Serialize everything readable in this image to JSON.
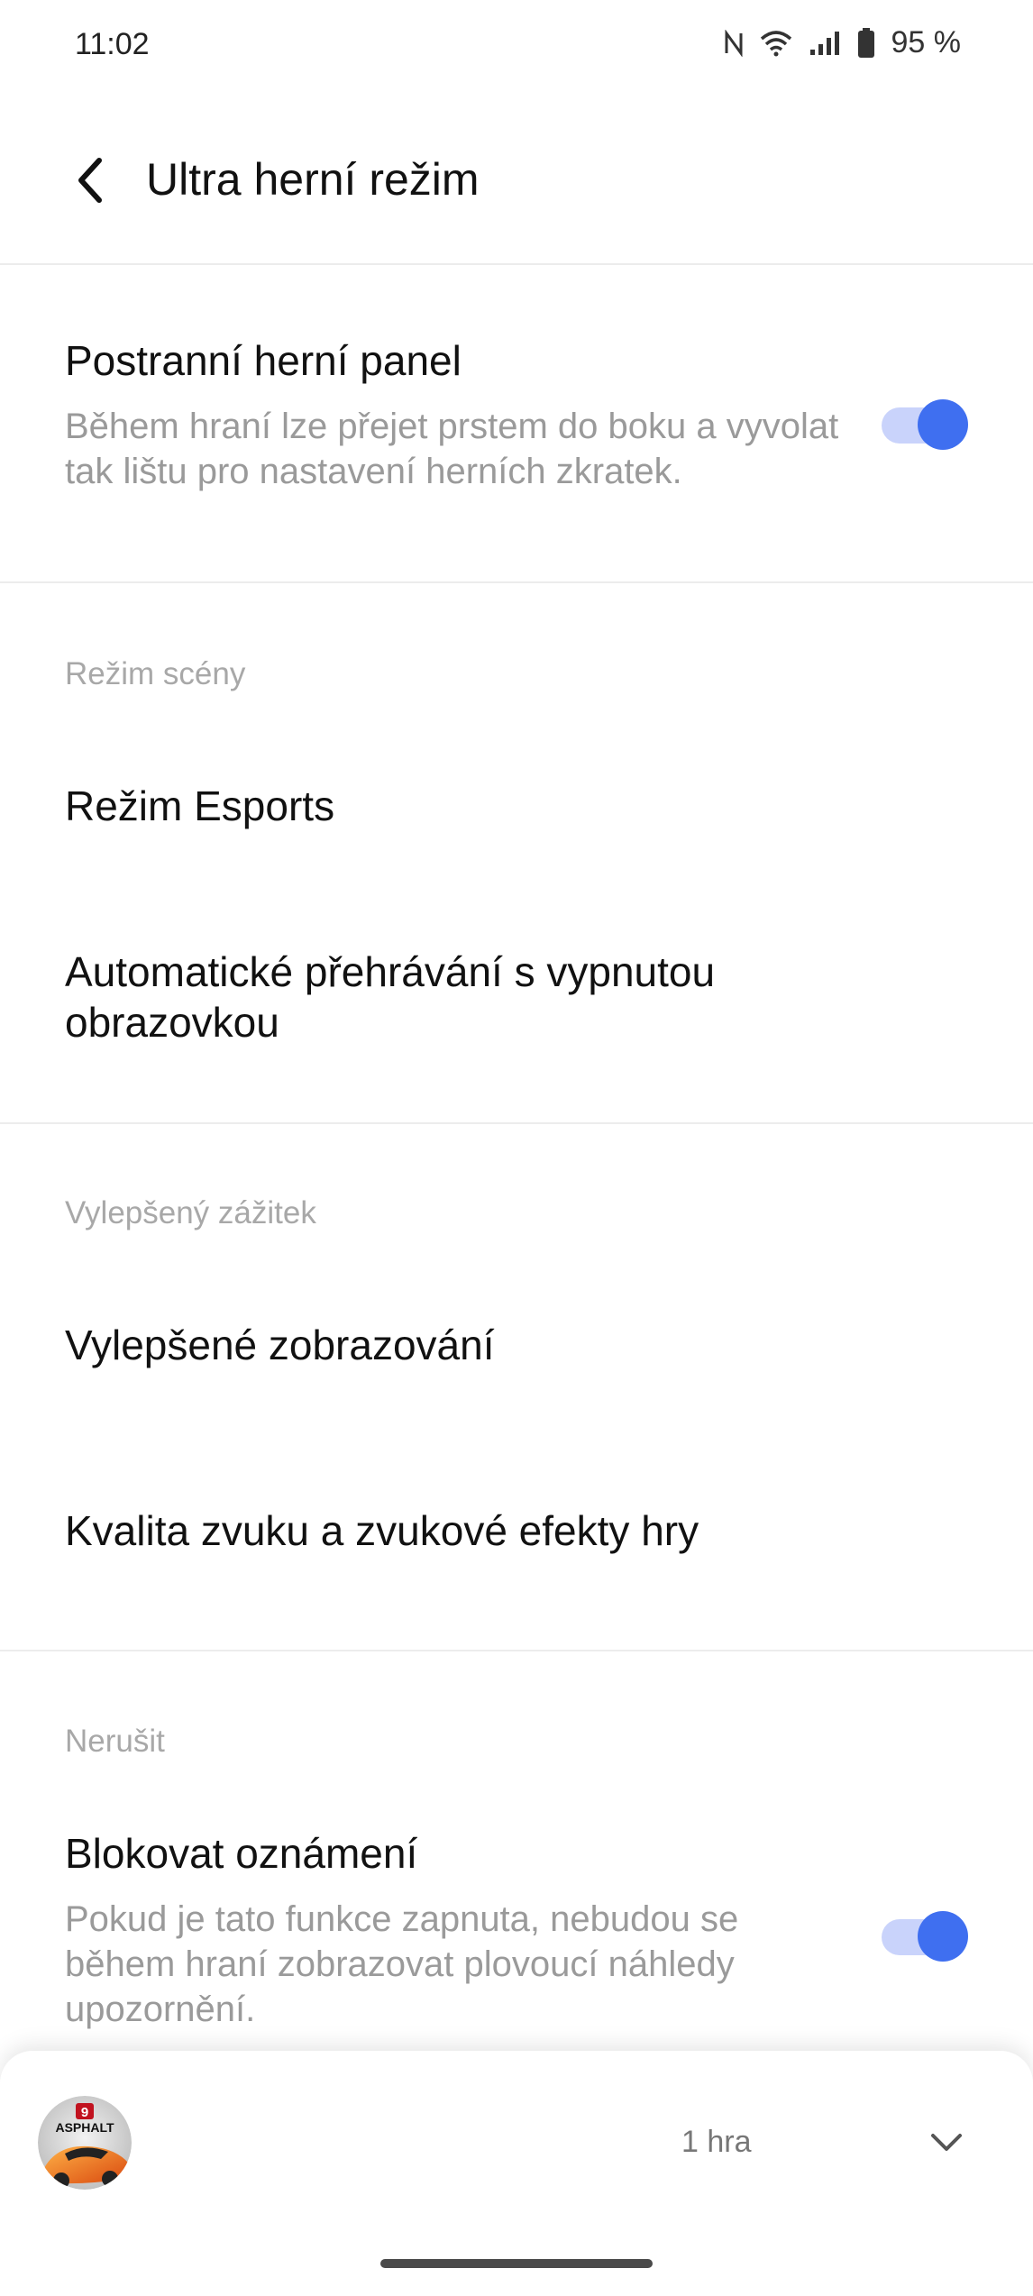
{
  "status_bar": {
    "time": "11:02",
    "battery": "95 %",
    "icons": [
      "nfc-icon",
      "wifi-icon",
      "signal-icon",
      "battery-icon"
    ]
  },
  "header": {
    "title": "Ultra herní režim",
    "back_icon": "back-arrow-icon"
  },
  "settings": {
    "side_panel": {
      "title": "Postranní herní panel",
      "description": "Během hraní lze přejet prstem do boku a vyvolat tak lištu pro nastavení herních zkratek.",
      "enabled": true
    },
    "scene_mode": {
      "header": "Režim scény",
      "esports": "Režim Esports",
      "auto_play": "Automatické přehrávání s vypnutou obrazovkou"
    },
    "enhanced": {
      "header": "Vylepšený zážitek",
      "display": "Vylepšené zobrazování",
      "audio": "Kvalita zvuku a zvukové efekty hry"
    },
    "dnd": {
      "header": "Nerušit",
      "block_title": "Blokovat oznámení",
      "block_description": "Pokud je tato funkce zapnuta, nebudou se během hraní zobrazovat plovoucí náhledy upozornění.",
      "enabled": true
    }
  },
  "bottom_sheet": {
    "game_count": "1 hra",
    "game_logo_text": "ASPHALT",
    "game_logo_number": "9",
    "expand_icon": "chevron-down-icon"
  },
  "colors": {
    "accent": "#3f6ff0",
    "toggle_track": "#c9d3fb",
    "secondary_text": "#9a9a9a"
  }
}
